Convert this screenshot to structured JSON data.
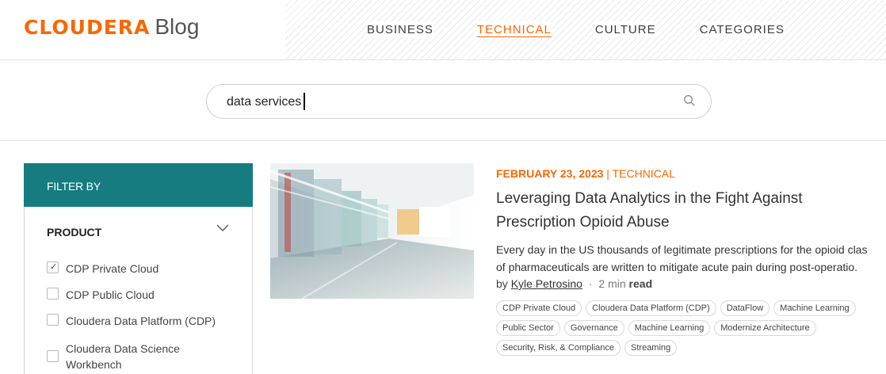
{
  "header": {
    "logo_word": "CLOUDERA",
    "logo_suffix": "Blog",
    "nav": [
      "BUSINESS",
      "TECHNICAL",
      "CULTURE",
      "CATEGORIES"
    ],
    "active_nav": "TECHNICAL"
  },
  "search": {
    "value": "data services"
  },
  "filter": {
    "heading": "FILTER BY",
    "product_label": "PRODUCT",
    "options": [
      {
        "label": "CDP Private Cloud",
        "checked": true
      },
      {
        "label": "CDP Public Cloud",
        "checked": false
      },
      {
        "label": "Cloudera Data Platform (CDP)",
        "checked": false
      },
      {
        "label": "Cloudera Data Science Workbench",
        "checked": false
      }
    ]
  },
  "article": {
    "date": "FEBRUARY 23, 2023",
    "separator": "|",
    "category": "TECHNICAL",
    "title": "Leveraging Data Analytics in the Fight Against Prescription Opioid Abuse",
    "excerpt_line1": "Every day in the US thousands of legitimate prescriptions for the opioid clas",
    "excerpt_line2": "of pharmaceuticals are written to mitigate acute pain during post-operatio.",
    "by": "by",
    "author": "Kyle Petrosino",
    "dot": "·",
    "minutes": "2 min",
    "read": "read",
    "tags_row1": [
      "CDP Private Cloud",
      "Cloudera Data Platform (CDP)",
      "DataFlow",
      "Machine Learning"
    ],
    "tags_row2": [
      "Public Sector",
      "Governance",
      "Machine Learning",
      "Modernize Architecture"
    ],
    "tags_row3": [
      "Security, Risk, & Compliance",
      "Streaming"
    ]
  },
  "colors": {
    "brand_orange": "#f96702",
    "filter_teal": "#167c80"
  }
}
